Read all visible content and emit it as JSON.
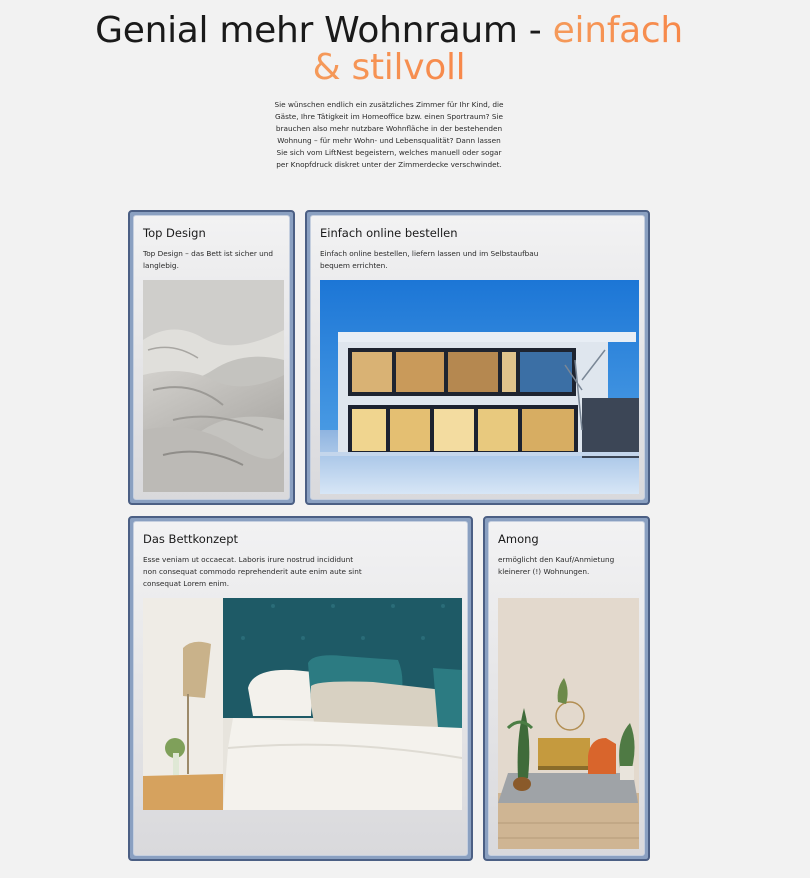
{
  "hero": {
    "title_main": "Genial mehr Wohnraum - ",
    "title_accent_1": "einfach",
    "title_accent_2": "& stilvoll",
    "text": "Sie wünschen endlich ein zusätzliches Zimmer für Ihr Kind, die Gäste, Ihre Tätigkeit im Homeoffice bzw. einen Sportraum? Sie brauchen also mehr nutzbare Wohnfläche in der bestehenden Wohnung – für mehr Wohn- und Lebensqualität? Dann lassen Sie sich vom LiftNest begeistern, welches manuell oder sogar per Knopfdruck diskret unter der Zimmerdecke verschwindet."
  },
  "cards": [
    {
      "title": "Top Design",
      "text": "Top Design – das Bett ist sicher und langlebig.",
      "image": "bed-sheets-photo"
    },
    {
      "title": "Einfach online bestellen",
      "text": "Einfach online bestellen, liefern lassen und im Selbstaufbau bequem errichten.",
      "image": "modern-house-photo"
    },
    {
      "title": "Das Bettkonzept",
      "text": "Esse veniam ut occaecat. Laboris irure nostrud incididunt non consequat commodo reprehenderit aute enim aute sint consequat Lorem enim.",
      "image": "bedroom-photo"
    },
    {
      "title": "Among",
      "text": "ermöglicht den Kauf/Anmietung kleinerer (!) Wohnungen.",
      "image": "living-room-photo"
    }
  ],
  "colors": {
    "accent": "#f7884a",
    "card_border": "#4b5f84",
    "card_frame": "#8aa0c1",
    "background": "#f2f2f2"
  }
}
